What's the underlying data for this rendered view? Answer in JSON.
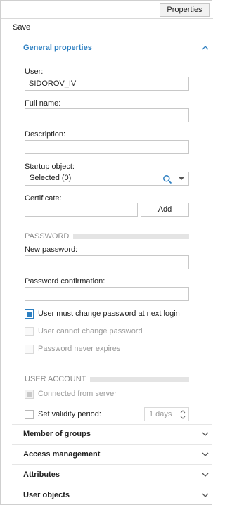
{
  "toolbar": {
    "properties_label": "Properties"
  },
  "actions": {
    "save_label": "Save"
  },
  "general": {
    "title": "General properties",
    "user_label": "User:",
    "user_value": "SIDOROV_IV",
    "fullname_label": "Full name:",
    "fullname_value": "",
    "description_label": "Description:",
    "description_value": "",
    "startup_label": "Startup object:",
    "startup_value": "Selected (0)",
    "certificate_label": "Certificate:",
    "certificate_value": "",
    "add_label": "Add"
  },
  "password": {
    "group_title": "PASSWORD",
    "new_label": "New password:",
    "new_value": "",
    "confirm_label": "Password confirmation:",
    "confirm_value": "",
    "must_change_label": "User must change password at next login",
    "must_change_checked": true,
    "cannot_change_label": "User cannot change password",
    "cannot_change_checked": false,
    "never_expires_label": "Password never expires",
    "never_expires_checked": false
  },
  "account": {
    "group_title": "USER ACCOUNT",
    "connected_label": "Connected from server",
    "connected_checked": true,
    "validity_label": "Set validity period:",
    "validity_checked": false,
    "validity_value": "1 days"
  },
  "sections": [
    {
      "title": "Member of groups"
    },
    {
      "title": "Access management"
    },
    {
      "title": "Attributes"
    },
    {
      "title": "User objects"
    }
  ],
  "colors": {
    "accent": "#2d7fc1",
    "border": "#c8c8c8",
    "disabled_text": "#9c9c9c"
  },
  "icons": [
    "chevron-up-icon",
    "search-icon",
    "dropdown-arrow-icon",
    "spinner-up-icon",
    "spinner-down-icon",
    "chevron-down-icon"
  ]
}
